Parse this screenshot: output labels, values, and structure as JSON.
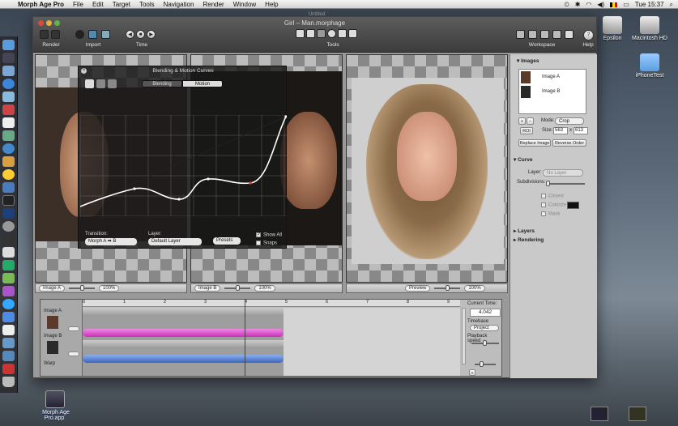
{
  "menubar": {
    "app_name": "Morph Age Pro",
    "items": [
      "File",
      "Edit",
      "Target",
      "Tools",
      "Navigation",
      "Render",
      "Window",
      "Help"
    ],
    "clock": "Tue 15:37"
  },
  "desktop": {
    "icons": [
      {
        "label": "Epsilon"
      },
      {
        "label": "Macintosh HD"
      },
      {
        "label": "iPhoneTest"
      },
      {
        "label": "Morph Age Pro.app"
      }
    ]
  },
  "window": {
    "subtitle": "Untitled",
    "title": "Girl – Man.morphage",
    "toolbar": {
      "render_label": "Render",
      "import_label": "Import",
      "time_label": "Time",
      "tools_label": "Tools",
      "workspace_label": "Workspace",
      "help_label": "Help"
    }
  },
  "panes": {
    "pane1_select": "Image A",
    "pane2_select": "Image B",
    "pane3_select": "Preview",
    "zoom": "100%"
  },
  "blend_dialog": {
    "title": "Blending & Motion Curves",
    "tabs": [
      "Blending",
      "Motion"
    ],
    "active_tab": "Motion",
    "transition_label": "Transition:",
    "transition_value": "Morph A ➡ B",
    "layer_label": "Layer:",
    "layer_value": "Default Layer",
    "presets_label": "Presets",
    "show_all_label": "Show All",
    "snaps_label": "Snaps",
    "show_all_checked": true,
    "snaps_checked": false
  },
  "inspector": {
    "images_header": "Images",
    "image_items": [
      "Image A",
      "Image B"
    ],
    "mode_label": "Mode:",
    "mode_value": "Crop",
    "roi_label": "ROI",
    "size_label": "Size:",
    "size_w": "563",
    "size_h": "613",
    "replace_image": "Replace Image",
    "reverse_order": "Reverse Order",
    "curve_header": "Curve",
    "layer_label": "Layer:",
    "layer_value": "No Layer",
    "subdivisions_label": "Subdivisions:",
    "closed_label": "Closed",
    "colorize_label": "Colorize",
    "mask_label": "Mask",
    "layers_header": "Layers",
    "rendering_header": "Rendering"
  },
  "timeline": {
    "rows": [
      "Image A",
      "Image B",
      "Warp"
    ],
    "ticks": [
      "0",
      "1",
      "2",
      "3",
      "4",
      "5",
      "6",
      "7",
      "8",
      "9"
    ],
    "current_time_label": "Current Time:",
    "current_time": "4.042",
    "timebase_label": "Timebase",
    "timebase_value": "Project",
    "playback_label": "Playback speed"
  },
  "colors": {
    "track_a": "#d93fc9",
    "track_b": "#4f78d0",
    "curve": "#ffffff"
  }
}
